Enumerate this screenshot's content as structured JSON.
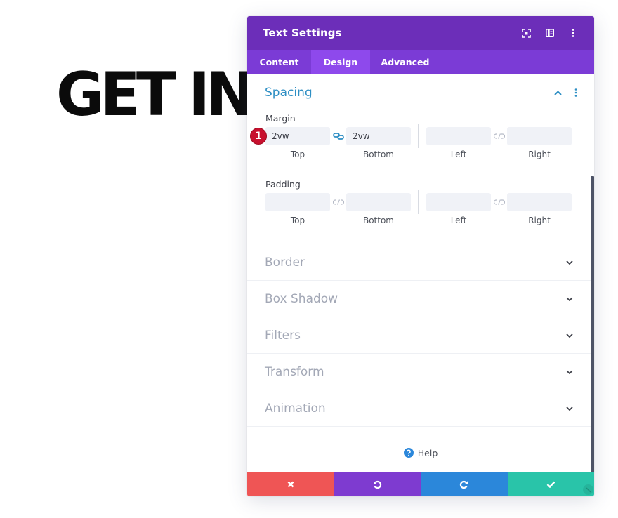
{
  "page": {
    "hero_text": "GET IN"
  },
  "modal": {
    "title": "Text Settings",
    "header_icons": [
      "focus-icon",
      "sidebar-layout-icon",
      "more-options-icon"
    ],
    "tabs": [
      {
        "label": "Content",
        "active": false
      },
      {
        "label": "Design",
        "active": true
      },
      {
        "label": "Advanced",
        "active": false
      }
    ]
  },
  "spacing": {
    "title": "Spacing",
    "expanded": true,
    "margin": {
      "label": "Margin",
      "badge": "1",
      "top": "2vw",
      "bottom": "2vw",
      "left": "",
      "right": "",
      "top_bottom_linked": true,
      "left_right_linked": false,
      "sub_labels": [
        "Top",
        "Bottom",
        "Left",
        "Right"
      ]
    },
    "padding": {
      "label": "Padding",
      "top": "",
      "bottom": "",
      "left": "",
      "right": "",
      "sub_labels": [
        "Top",
        "Bottom",
        "Left",
        "Right"
      ]
    }
  },
  "sections": [
    {
      "title": "Border"
    },
    {
      "title": "Box Shadow"
    },
    {
      "title": "Filters"
    },
    {
      "title": "Transform"
    },
    {
      "title": "Animation"
    }
  ],
  "help": {
    "label": "Help"
  },
  "footer": {
    "buttons": [
      {
        "name": "cancel",
        "icon": "close-icon",
        "color": "#ef5555"
      },
      {
        "name": "undo",
        "icon": "undo-icon",
        "color": "#7e3bd0"
      },
      {
        "name": "redo",
        "icon": "redo-icon",
        "color": "#2b87da"
      },
      {
        "name": "save",
        "icon": "check-icon",
        "color": "#29c4a9"
      }
    ]
  },
  "colors": {
    "header": "#6c2eb9",
    "tabs": "#7b3bd6",
    "active_tab": "#8e49ec",
    "accent_blue": "#2e8fc4",
    "badge_red": "#c8102e"
  }
}
